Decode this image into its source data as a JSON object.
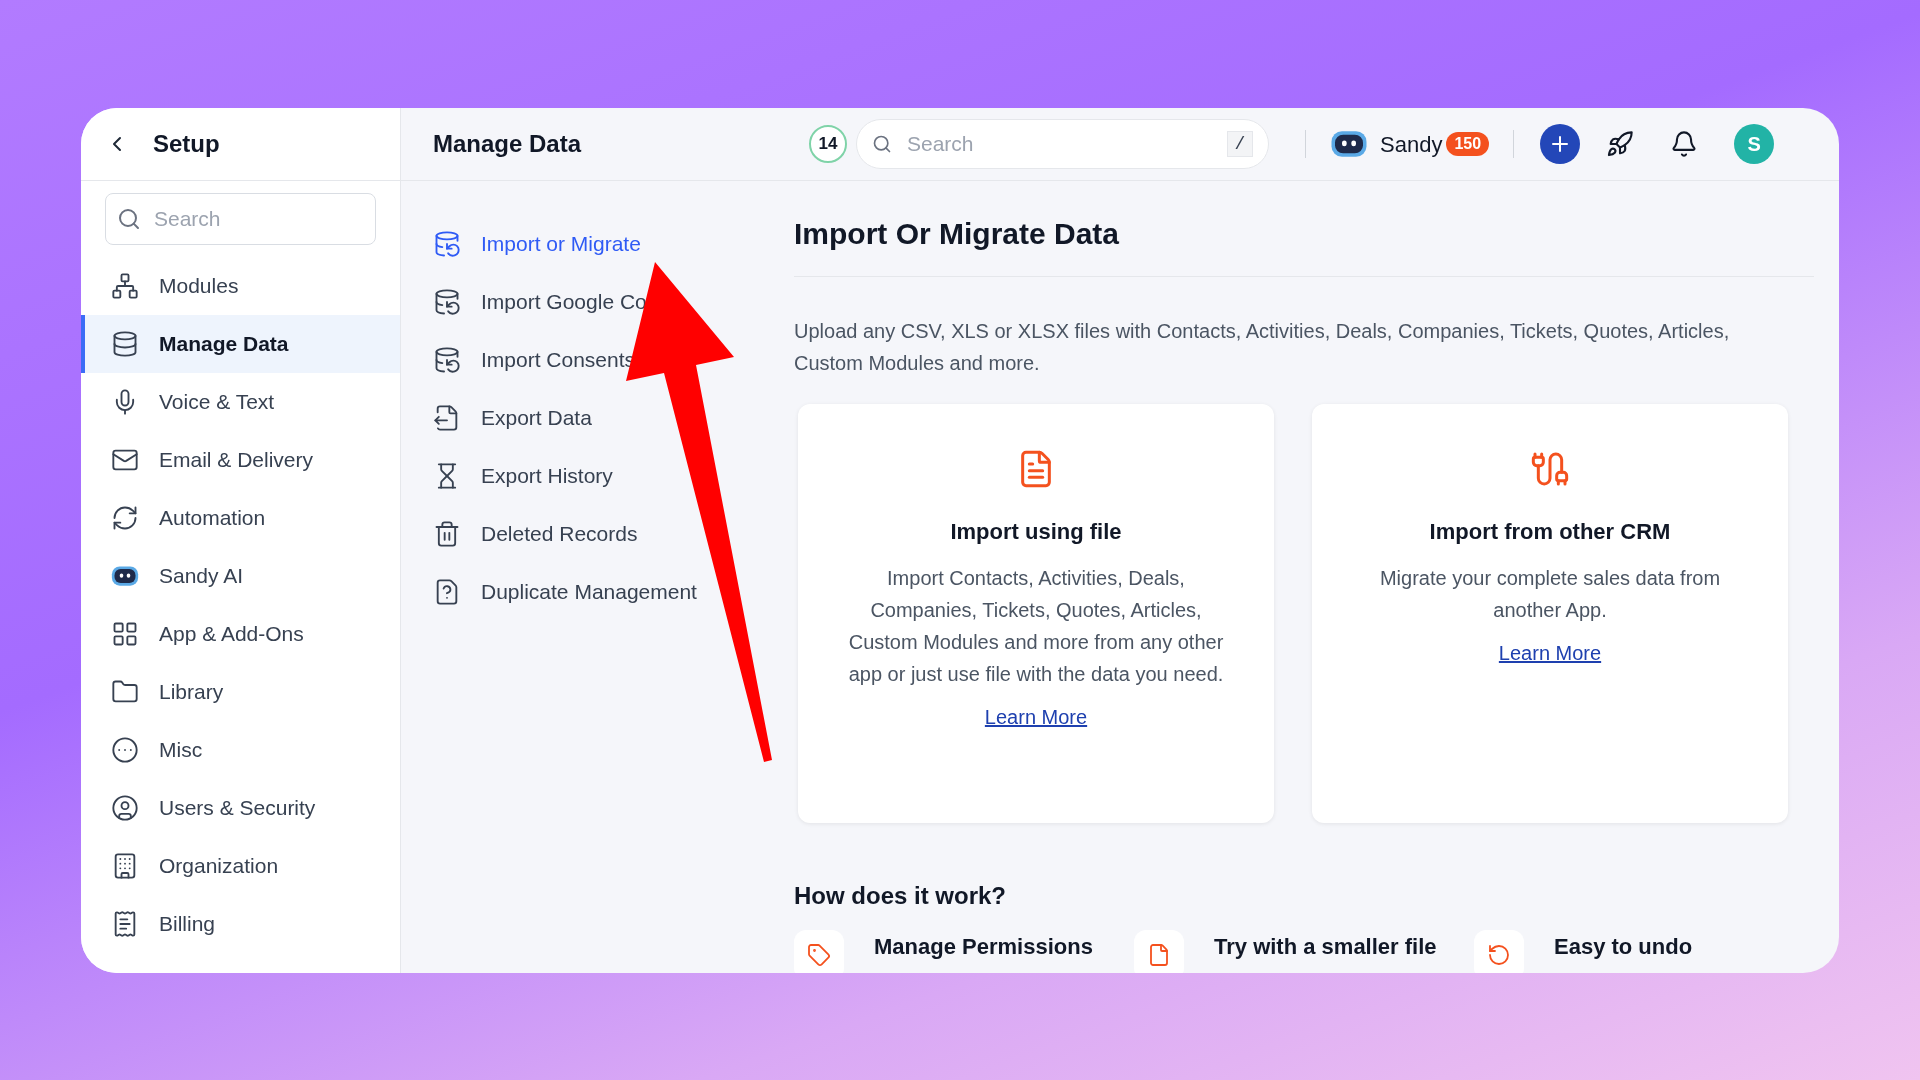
{
  "setup": {
    "title": "Setup",
    "search": {
      "placeholder": "Search"
    },
    "items": [
      {
        "label": "Modules",
        "selected": false
      },
      {
        "label": "Manage Data",
        "selected": true
      },
      {
        "label": "Voice & Text",
        "selected": false
      },
      {
        "label": "Email & Delivery",
        "selected": false
      },
      {
        "label": "Automation",
        "selected": false
      },
      {
        "label": "Sandy AI",
        "selected": false
      },
      {
        "label": "App & Add-Ons",
        "selected": false
      },
      {
        "label": "Library",
        "selected": false
      },
      {
        "label": "Misc",
        "selected": false
      },
      {
        "label": "Users & Security",
        "selected": false
      },
      {
        "label": "Organization",
        "selected": false
      },
      {
        "label": "Billing",
        "selected": false
      }
    ]
  },
  "header": {
    "title": "Manage Data",
    "count": "14",
    "search": {
      "placeholder": "Search",
      "shortcut": "/"
    },
    "user": "Sandy",
    "credits": "150",
    "avatar": "S"
  },
  "subnav": [
    {
      "label": "Import or Migrate",
      "selected": true
    },
    {
      "label": "Import Google Co",
      "selected": false
    },
    {
      "label": "Import Consents",
      "selected": false
    },
    {
      "label": "Export Data",
      "selected": false
    },
    {
      "label": "Export History",
      "selected": false
    },
    {
      "label": "Deleted Records",
      "selected": false
    },
    {
      "label": "Duplicate Management",
      "selected": false
    }
  ],
  "content": {
    "title": "Import Or Migrate Data",
    "description": "Upload any CSV, XLS or XLSX files with Contacts, Activities, Deals, Companies, Tickets, Quotes, Articles, Custom Modules and more.",
    "cards": [
      {
        "title": "Import using file",
        "description": "Import Contacts, Activities, Deals, Companies, Tickets, Quotes, Articles, Custom Modules and more from any other app or just use file with the data you need.",
        "link": "Learn More"
      },
      {
        "title": "Import from other CRM",
        "description": "Migrate your complete sales data from another App.",
        "link": "Learn More"
      }
    ],
    "how_title": "How does it work?",
    "steps": [
      {
        "title": "Manage Permissions"
      },
      {
        "title": "Try with a smaller file"
      },
      {
        "title": "Easy to undo"
      }
    ]
  }
}
